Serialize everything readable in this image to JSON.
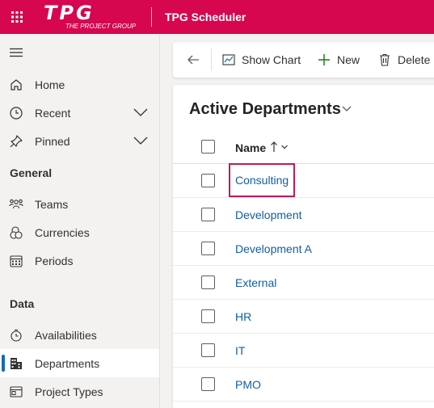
{
  "header": {
    "logo_text": "TPG",
    "logo_subtext": "THE PROJECT GROUP",
    "app_title": "TPG Scheduler"
  },
  "sidebar": {
    "items_top": [
      {
        "label": "Home",
        "icon": "home-icon"
      },
      {
        "label": "Recent",
        "icon": "clock-icon",
        "expandable": true
      },
      {
        "label": "Pinned",
        "icon": "pin-icon",
        "expandable": true
      }
    ],
    "general_heading": "General",
    "general_items": [
      {
        "label": "Teams",
        "icon": "people-team-icon"
      },
      {
        "label": "Currencies",
        "icon": "coins-icon"
      },
      {
        "label": "Periods",
        "icon": "calendar-icon"
      }
    ],
    "data_heading": "Data",
    "data_items": [
      {
        "label": "Availabilities",
        "icon": "availability-icon"
      },
      {
        "label": "Departments",
        "icon": "building-icon",
        "selected": true
      },
      {
        "label": "Project Types",
        "icon": "project-types-icon"
      }
    ]
  },
  "commandbar": {
    "back": "back-arrow-icon",
    "show_chart": "Show Chart",
    "new": "New",
    "delete": "Delete"
  },
  "view": {
    "title": "Active Departments",
    "column_name": "Name",
    "sort": "ascending",
    "rows": [
      "Consulting",
      "Development",
      "Development A",
      "External",
      "HR",
      "IT",
      "PMO"
    ],
    "focused_row": "Consulting"
  },
  "colors": {
    "brand": "#d6064f",
    "link": "#115ea3",
    "selected_indicator": "#0f6cbd",
    "focus_outline": "#c2185b"
  }
}
